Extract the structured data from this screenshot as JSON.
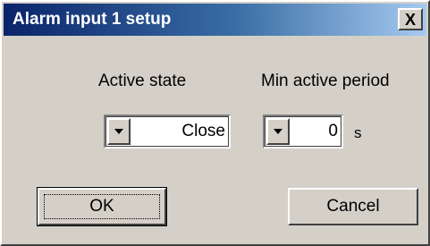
{
  "window": {
    "title": "Alarm input 1 setup",
    "close_glyph": "X"
  },
  "fields": {
    "active_state": {
      "label": "Active state",
      "value": "Close",
      "dropdown_icon": "chevron-down-icon"
    },
    "min_active_period": {
      "label": "Min active period",
      "value": "0",
      "unit": "s",
      "dropdown_icon": "chevron-down-icon"
    }
  },
  "buttons": {
    "ok_label": "OK",
    "cancel_label": "Cancel"
  },
  "colors": {
    "face": "#d4d0c8",
    "title_start": "#0a246a",
    "title_end": "#a6caf0"
  }
}
